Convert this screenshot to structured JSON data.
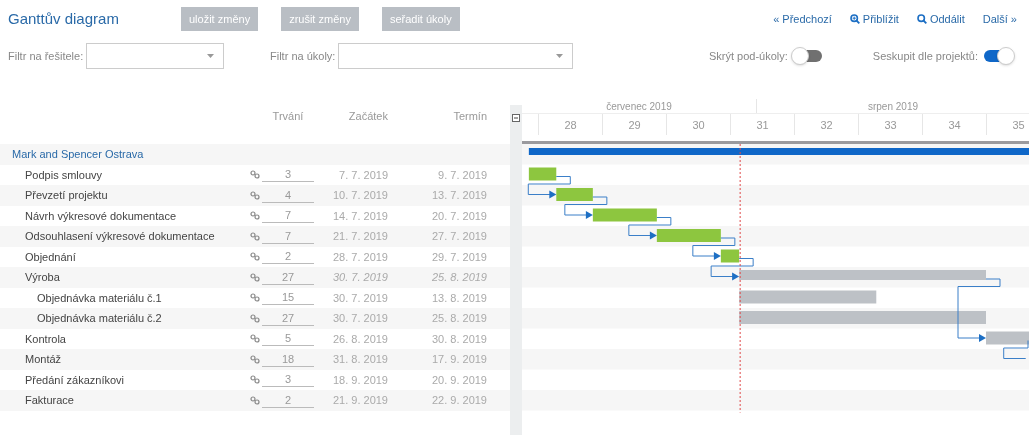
{
  "title": "Ganttův diagram",
  "actions": [
    "uložit změny",
    "zrušit změny",
    "seřadit úkoly"
  ],
  "navigation": [
    {
      "kind": "prev",
      "label": "« Předchozí"
    },
    {
      "kind": "zoom_in",
      "label": "Přiblížit"
    },
    {
      "kind": "zoom_out",
      "label": "Oddálit"
    },
    {
      "kind": "next",
      "label": "Další »"
    }
  ],
  "filters": [
    {
      "kind": "select",
      "label": "Filtr na řešitele:"
    },
    {
      "kind": "select_wide",
      "label": "Filtr na úkoly:"
    }
  ],
  "toggles": [
    {
      "label": "Skrýt pod-úkoly:",
      "on": false
    },
    {
      "label": "Seskupit dle projektů:",
      "on": true
    }
  ],
  "columns": [
    "Trvání",
    "Začátek",
    "Termín"
  ],
  "timeline": {
    "months": [
      "červenec 2019",
      "srpen 2019"
    ],
    "weeks": [
      "28",
      "29",
      "30",
      "31",
      "32",
      "33",
      "34",
      "35"
    ]
  },
  "projects": [
    {
      "name": "Mark and Spencer Ostrava",
      "tasks": [
        {
          "kind": "task",
          "name": "Podpis smlouvy",
          "duration": "3",
          "start": "7. 7. 2019",
          "end": "9. 7. 2019"
        },
        {
          "kind": "task",
          "name": "Převzetí projektu",
          "duration": "4",
          "start": "10. 7. 2019",
          "end": "13. 7. 2019"
        },
        {
          "kind": "task",
          "name": "Návrh výkresové dokumentace",
          "duration": "7",
          "start": "14. 7. 2019",
          "end": "20. 7. 2019"
        },
        {
          "kind": "task",
          "name": "Odsouhlasení výkresové dokumentace",
          "duration": "7",
          "start": "21. 7. 2019",
          "end": "27. 7. 2019"
        },
        {
          "kind": "task",
          "name": "Objednání",
          "duration": "2",
          "start": "28. 7. 2019",
          "end": "29. 7. 2019"
        },
        {
          "kind": "summary",
          "name": "Výroba",
          "duration": "27",
          "start": "30. 7. 2019",
          "end": "25. 8. 2019",
          "children": [
            {
              "name": "Objednávka materiálu č.1",
              "duration": "15",
              "start": "30. 7. 2019",
              "end": "13. 8. 2019"
            },
            {
              "name": "Objednávka materiálu č.2",
              "duration": "27",
              "start": "30. 7. 2019",
              "end": "25. 8. 2019"
            }
          ]
        },
        {
          "kind": "task",
          "name": "Kontrola",
          "duration": "5",
          "start": "26. 8. 2019",
          "end": "30. 8. 2019"
        },
        {
          "kind": "task",
          "name": "Montáž",
          "duration": "18",
          "start": "31. 8. 2019",
          "end": "17. 9. 2019"
        },
        {
          "kind": "task",
          "name": "Předání zákazníkovi",
          "duration": "3",
          "start": "18. 9. 2019",
          "end": "20. 9. 2019"
        },
        {
          "kind": "task",
          "name": "Fakturace",
          "duration": "2",
          "start": "21. 9. 2019",
          "end": "22. 9. 2019"
        }
      ]
    }
  ]
}
